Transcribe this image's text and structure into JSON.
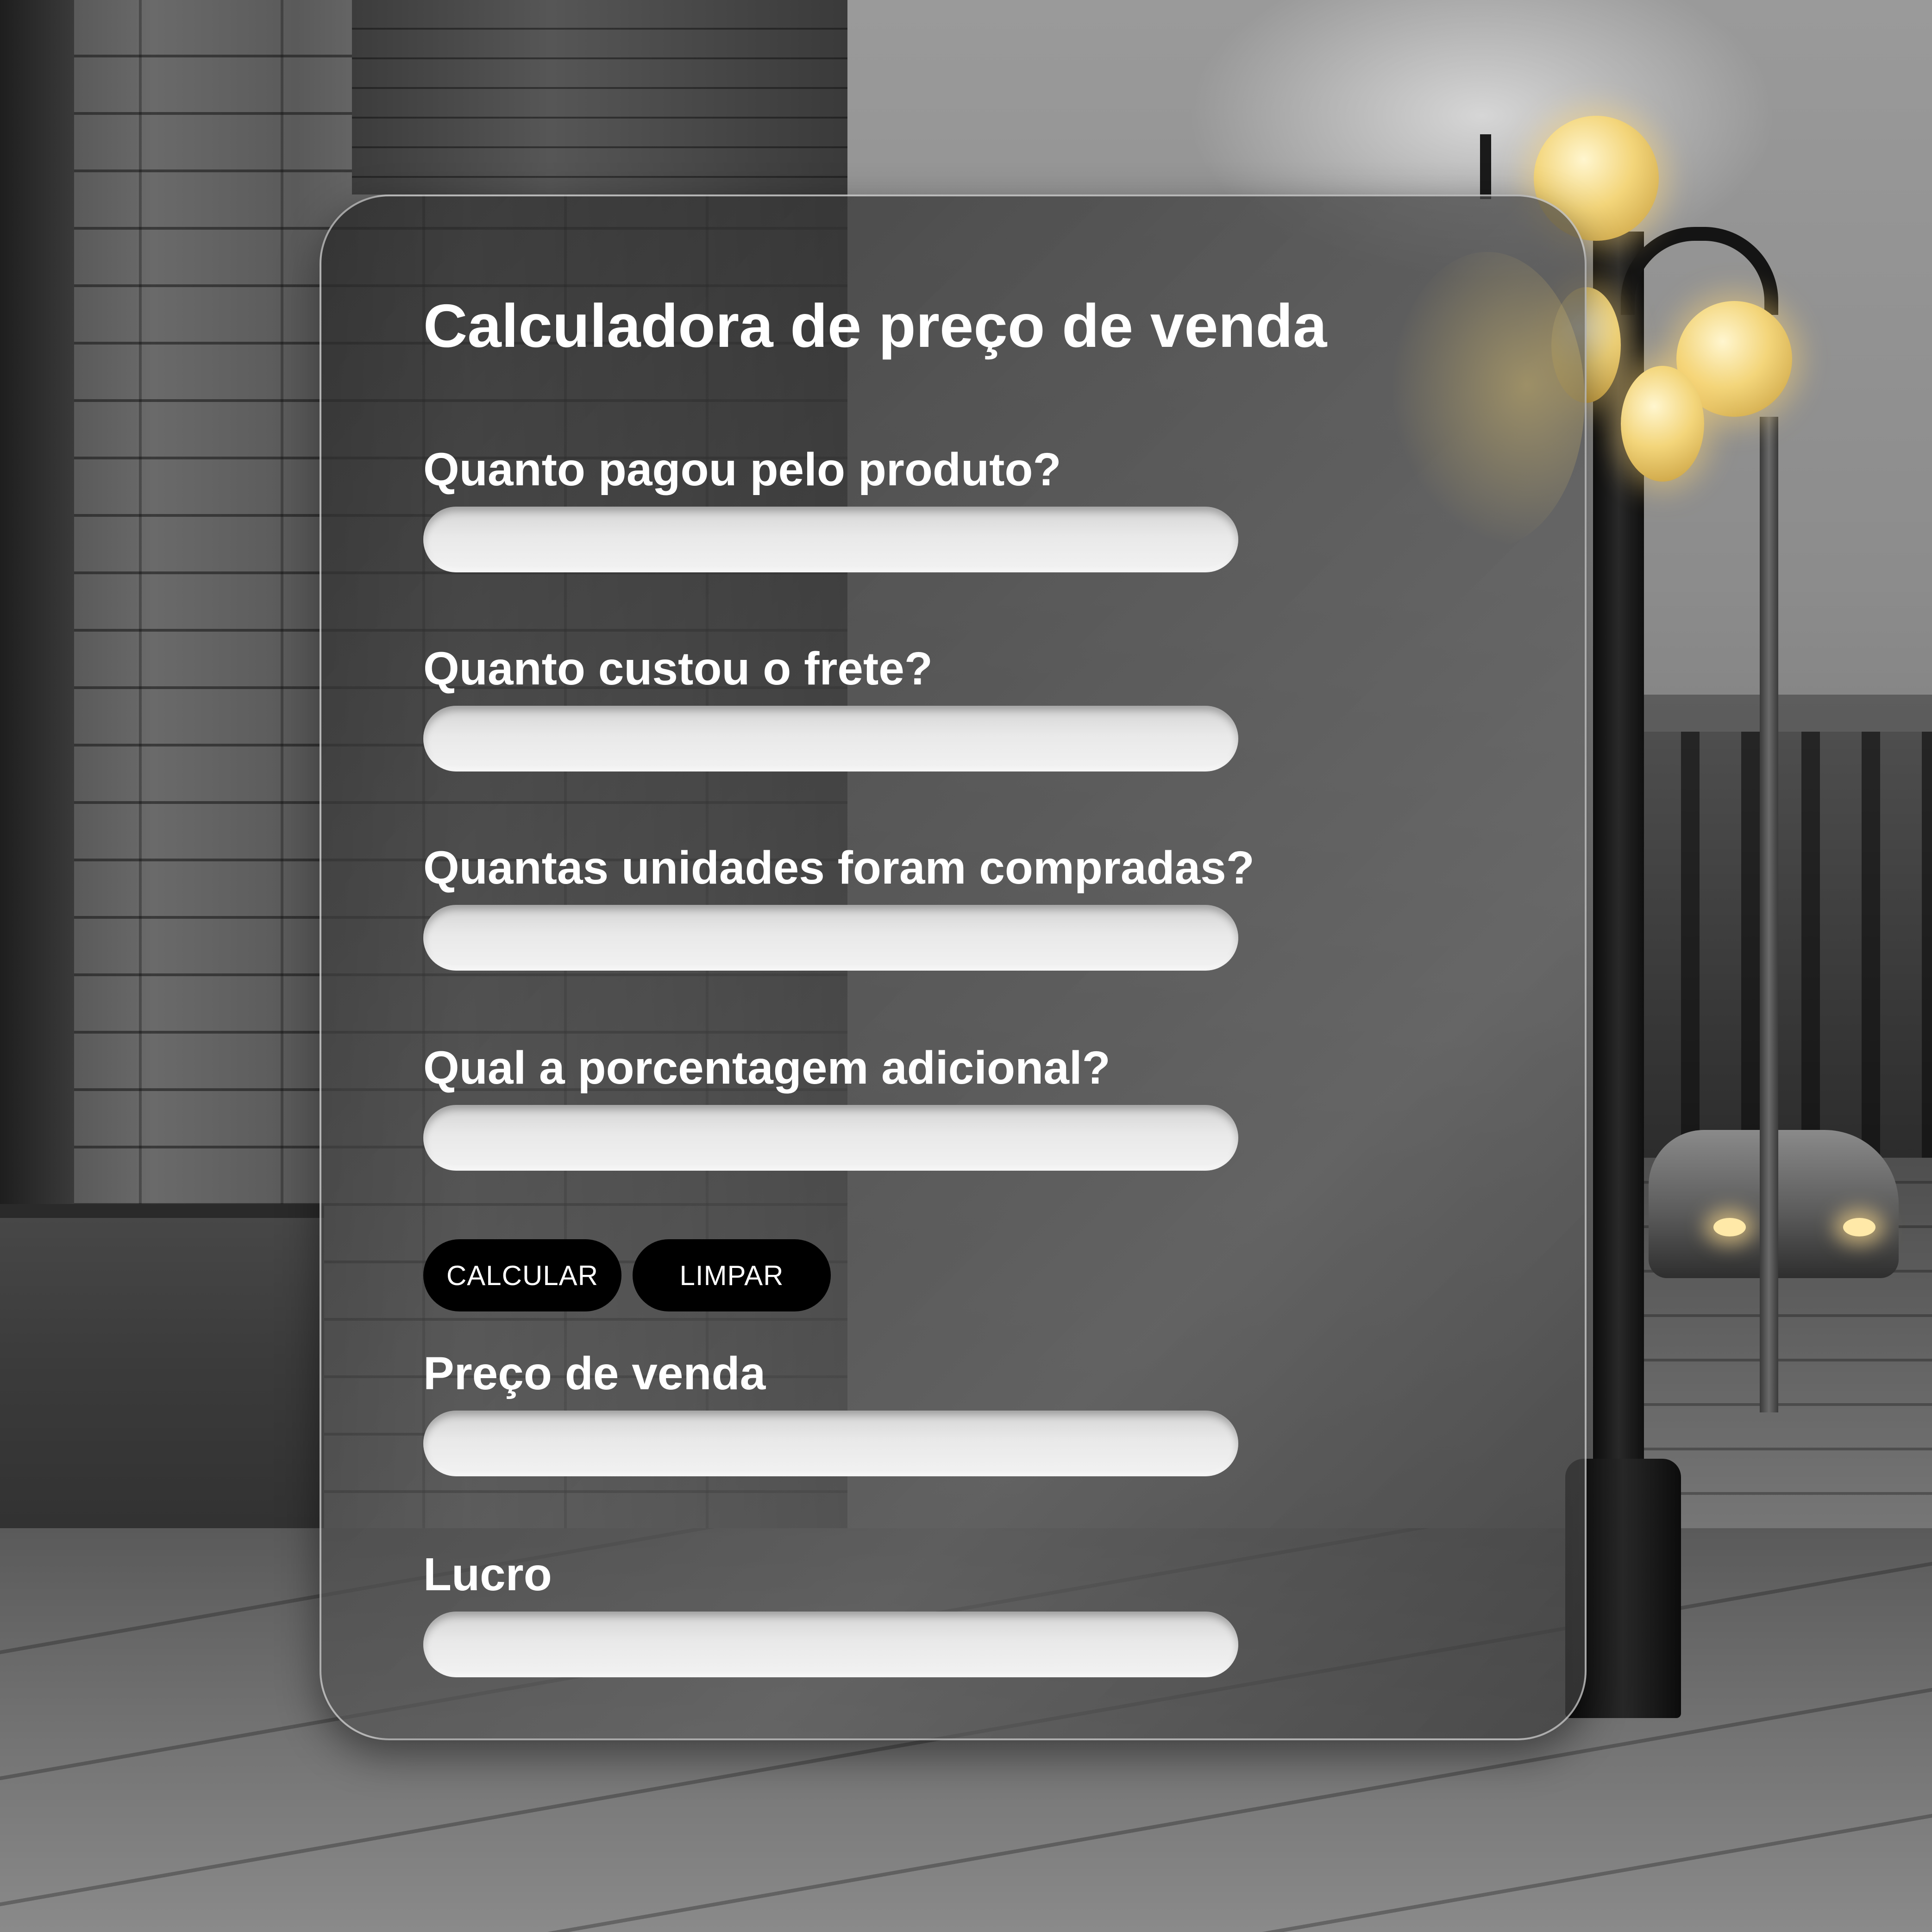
{
  "page": {
    "title": "Calculadora de preço de venda"
  },
  "form": {
    "fields": [
      {
        "label": "Quanto pagou pelo produto?",
        "value": "",
        "placeholder": ""
      },
      {
        "label": "Quanto custou o frete?",
        "value": "",
        "placeholder": ""
      },
      {
        "label": "Quantas unidades foram compradas?",
        "value": "",
        "placeholder": ""
      },
      {
        "label": "Qual a porcentagem adicional?",
        "value": "",
        "placeholder": ""
      }
    ],
    "buttons": {
      "calculate_label": "CALCULAR",
      "clear_label": "LIMPAR"
    }
  },
  "results": {
    "fields": [
      {
        "label": "Preço de venda",
        "value": ""
      },
      {
        "label": "Lucro",
        "value": ""
      }
    ]
  },
  "colors": {
    "button_bg": "#000000",
    "text": "#ffffff",
    "input_bg": "#ececec"
  }
}
